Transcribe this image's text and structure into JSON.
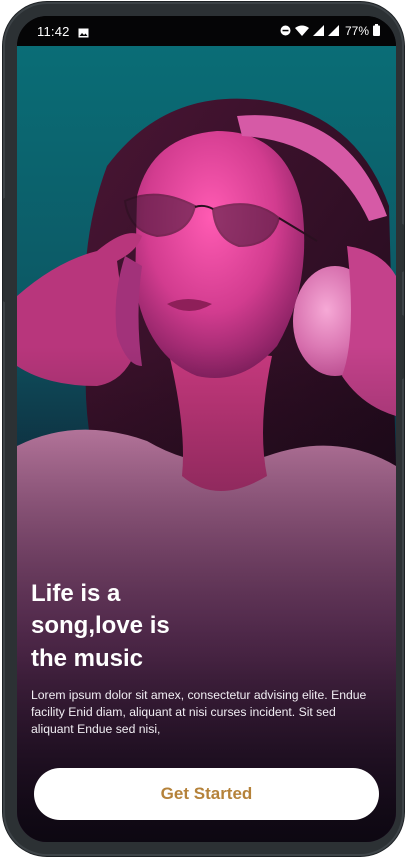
{
  "status_bar": {
    "time": "11:42",
    "battery": "77%",
    "icons": [
      "image-notification-icon",
      "do-not-disturb-icon",
      "wifi-icon",
      "signal-icon",
      "signal-icon",
      "battery-icon"
    ]
  },
  "onboarding": {
    "title": "Life is a\nsong,love is\nthe music",
    "description": "Lorem ipsum dolor sit amex, consectetur advising elite. Endue facility Enid diam, aliquant at nisi curses incident. Sit sed aliquant Endue sed nisi,",
    "cta_label": "Get Started"
  },
  "colors": {
    "background_teal": "#0a6d76",
    "magenta_light": "#e0469f",
    "cta_text": "#b5823a",
    "cta_background": "#ffffff",
    "device_frame": "#2c3134"
  }
}
